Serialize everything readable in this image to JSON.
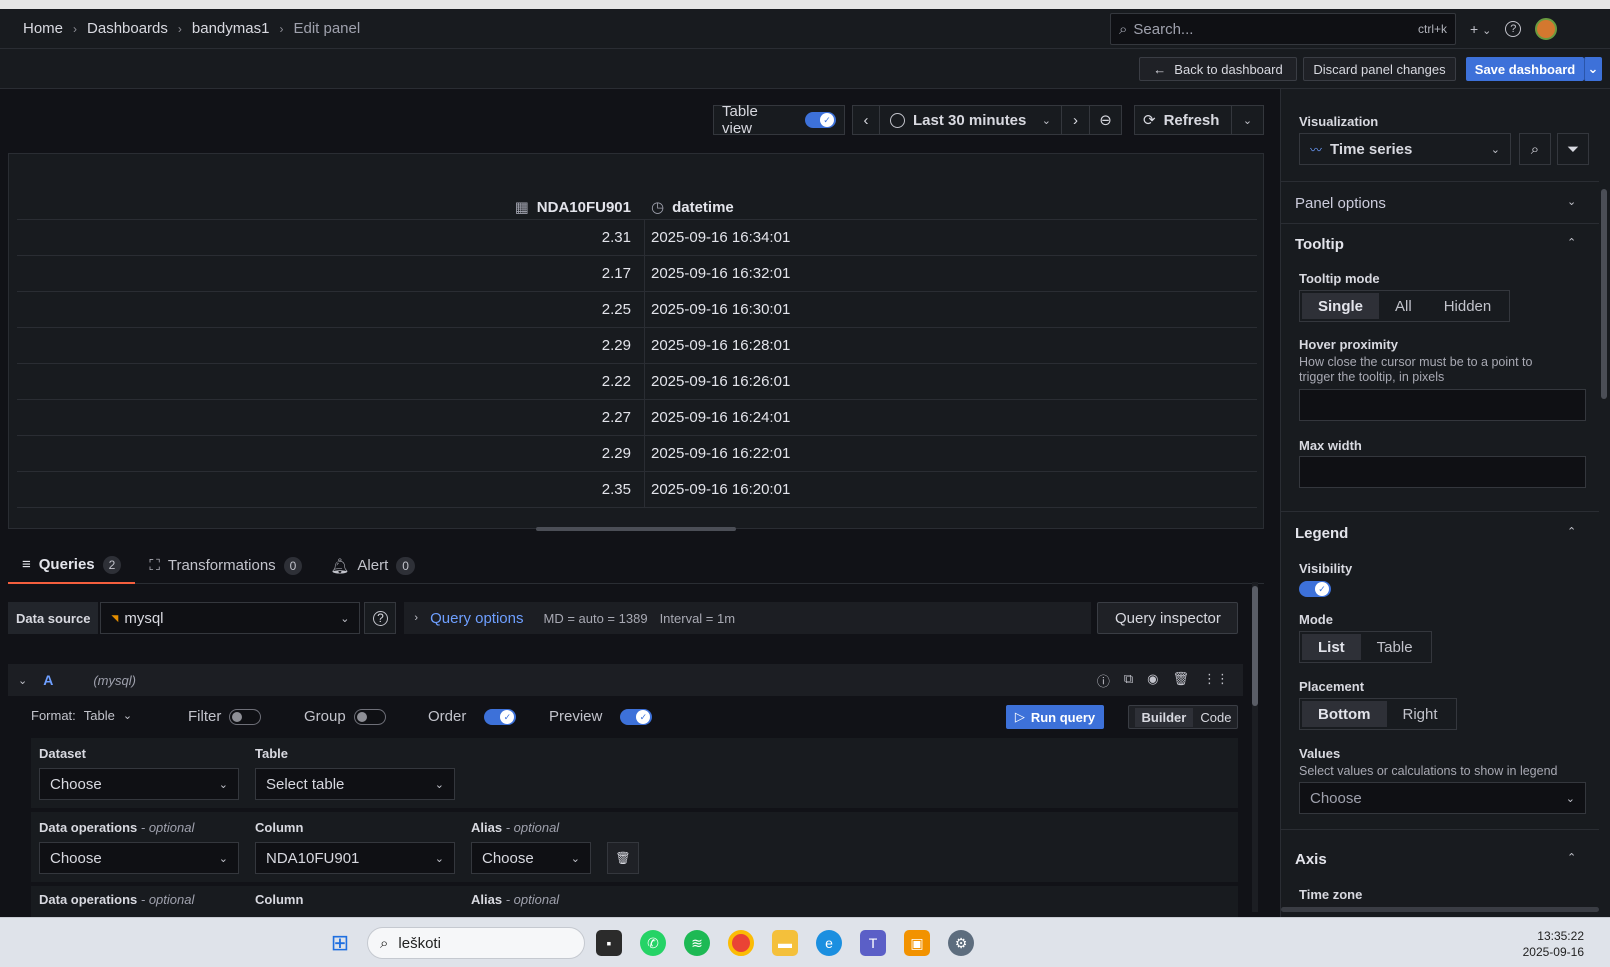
{
  "breadcrumb": {
    "home": "Home",
    "dashboards": "Dashboards",
    "dashboard": "bandymas1",
    "current": "Edit panel"
  },
  "search": {
    "placeholder": "Search...",
    "shortcut": "ctrl+k"
  },
  "toolbar": {
    "back": "Back to dashboard",
    "discard": "Discard panel changes",
    "save": "Save dashboard"
  },
  "panel_controls": {
    "table_view": "Table view",
    "time_range": "Last 30 minutes",
    "refresh": "Refresh"
  },
  "table": {
    "columns": [
      "NDA10FU901",
      "datetime"
    ],
    "rows": [
      [
        "2.31",
        "2025-09-16 16:34:01"
      ],
      [
        "2.17",
        "2025-09-16 16:32:01"
      ],
      [
        "2.25",
        "2025-09-16 16:30:01"
      ],
      [
        "2.29",
        "2025-09-16 16:28:01"
      ],
      [
        "2.22",
        "2025-09-16 16:26:01"
      ],
      [
        "2.27",
        "2025-09-16 16:24:01"
      ],
      [
        "2.29",
        "2025-09-16 16:22:01"
      ],
      [
        "2.35",
        "2025-09-16 16:20:01"
      ]
    ]
  },
  "tabs": [
    {
      "label": "Queries",
      "count": "2"
    },
    {
      "label": "Transformations",
      "count": "0"
    },
    {
      "label": "Alert",
      "count": "0"
    }
  ],
  "query": {
    "datasource_label": "Data source",
    "datasource": "mysql",
    "options": "Query options",
    "md": "MD = auto = 1389",
    "interval": "Interval = 1m",
    "inspector": "Query inspector",
    "ref": "A",
    "ref_source": "(mysql)",
    "format_label": "Format:",
    "format": "Table",
    "filter": "Filter",
    "group": "Group",
    "order": "Order",
    "preview": "Preview",
    "run": "Run query",
    "builder": "Builder",
    "code": "Code",
    "dataset_label": "Dataset",
    "dataset": "Choose",
    "table_label": "Table",
    "table": "Select table",
    "dataops_label": "Data operations",
    "optional": "- optional",
    "column_label": "Column",
    "alias_label": "Alias",
    "dataops": "Choose",
    "column": "NDA10FU901",
    "alias": "Choose"
  },
  "side": {
    "viz_label": "Visualization",
    "viz": "Time series",
    "panel_options": "Panel options",
    "tooltip": "Tooltip",
    "tooltip_mode": "Tooltip mode",
    "tooltip_modes": [
      "Single",
      "All",
      "Hidden"
    ],
    "hover": "Hover proximity",
    "hover_desc": "How close the cursor must be to a point to trigger the tooltip, in pixels",
    "max_width": "Max width",
    "legend": "Legend",
    "visibility": "Visibility",
    "mode": "Mode",
    "modes": [
      "List",
      "Table"
    ],
    "placement": "Placement",
    "placements": [
      "Bottom",
      "Right"
    ],
    "values": "Values",
    "values_desc": "Select values or calculations to show in legend",
    "values_placeholder": "Choose",
    "axis": "Axis",
    "time_zone": "Time zone"
  },
  "taskbar": {
    "search": "leškoti",
    "time": "13:35:22",
    "date": "2025-09-16"
  }
}
